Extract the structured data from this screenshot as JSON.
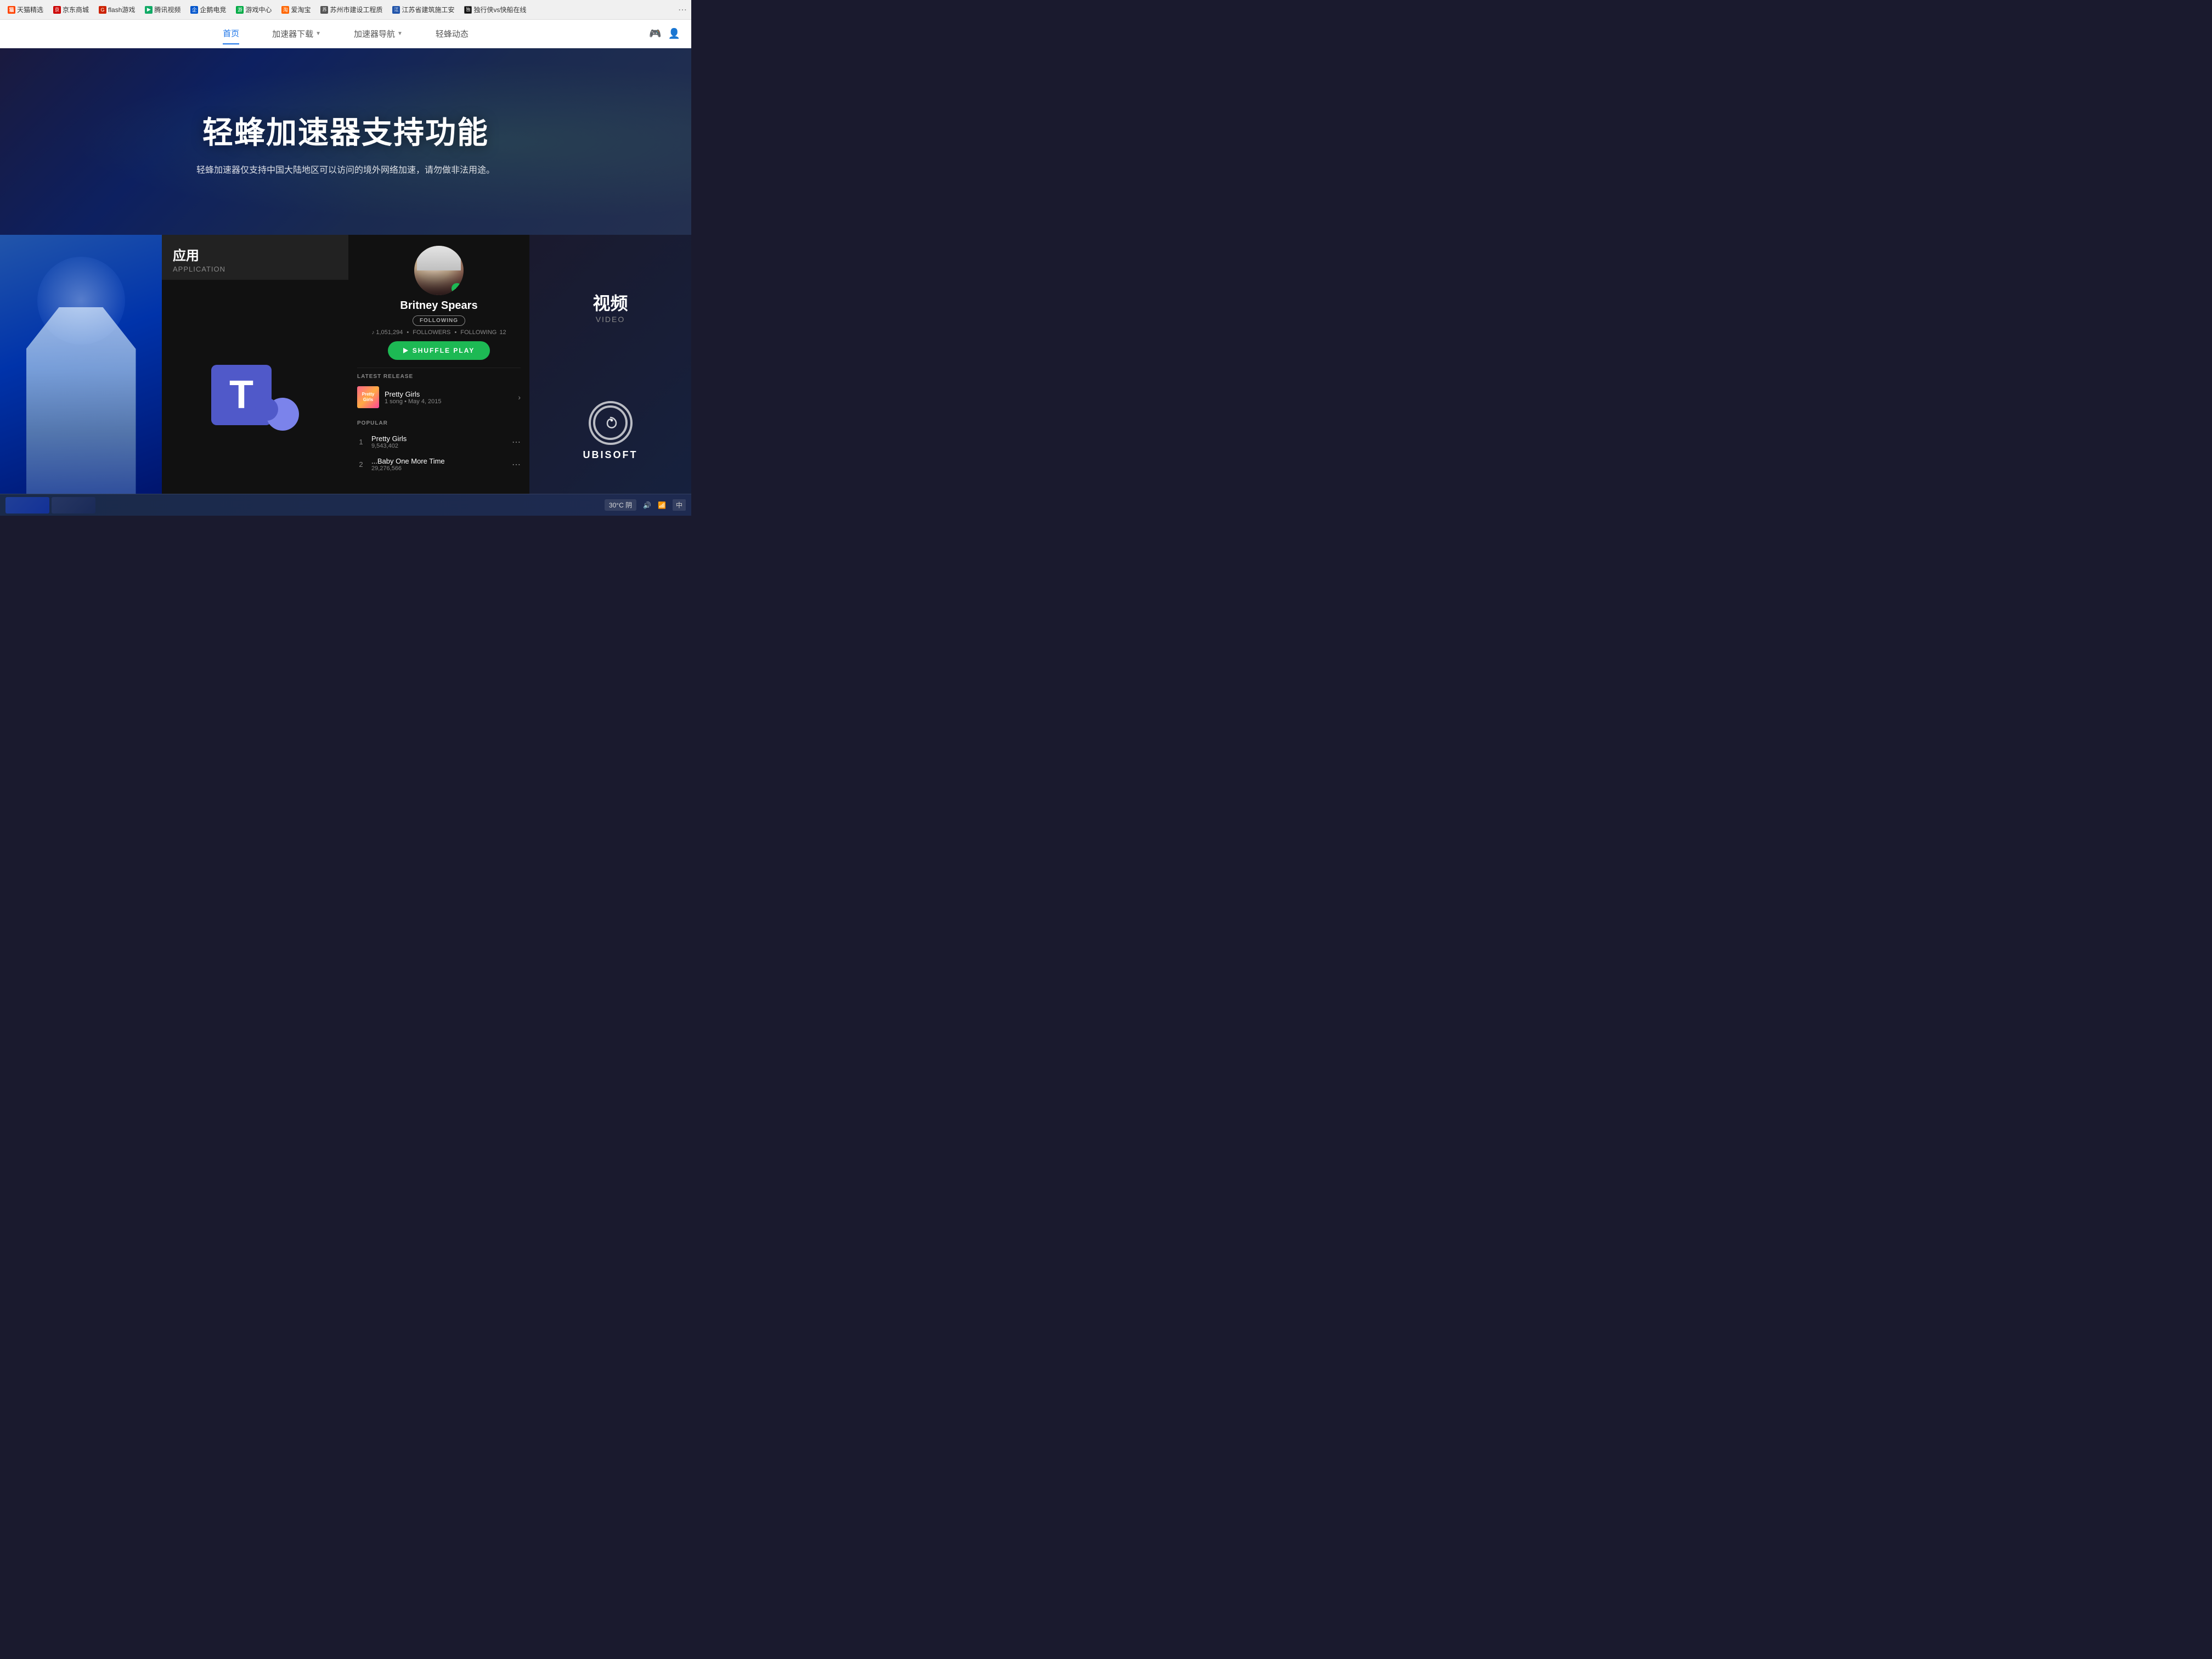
{
  "bookmarks": {
    "items": [
      {
        "label": "天猫精选",
        "color": "#ff4400"
      },
      {
        "label": "京东商城",
        "color": "#cc0000"
      },
      {
        "label": "flash游戏",
        "color": "#cc2200"
      },
      {
        "label": "腾讯视频",
        "color": "#3399ff"
      },
      {
        "label": "企鹅电竞",
        "color": "#0055cc"
      },
      {
        "label": "游戏中心",
        "color": "#00aa44"
      },
      {
        "label": "爱淘宝",
        "color": "#ff6600"
      },
      {
        "label": "苏州市建设工程质",
        "color": "#555"
      },
      {
        "label": "江苏省建筑施工安",
        "color": "#555"
      },
      {
        "label": "独行侠vs快船在线",
        "color": "#333"
      }
    ]
  },
  "nav": {
    "items": [
      {
        "label": "首页",
        "active": true
      },
      {
        "label": "加速器下载",
        "has_dropdown": true
      },
      {
        "label": "加速器导航",
        "has_dropdown": true
      },
      {
        "label": "轻蜂动态"
      }
    ]
  },
  "hero": {
    "title": "轻蜂加速器支持功能",
    "subtitle": "轻蜂加速器仅支持中国大陆地区可以访问的境外网络加速，请勿做非法用途。"
  },
  "app_panel": {
    "title_zh": "应用",
    "title_en": "APPLICATION"
  },
  "spotify": {
    "artist_name": "Britney Spears",
    "verified": true,
    "following_label": "FOLLOWING",
    "followers_count": "1,051,294",
    "following_count": "12",
    "followers_label": "FOLLOWERS",
    "following_label2": "FOLLOWING",
    "shuffle_label": "SHUFFLE PLAY",
    "latest_release_label": "LATEST RELEASE",
    "release_title": "Pretty Girls",
    "release_meta": "1 song • May 4, 2015",
    "popular_label": "POPULAR",
    "tracks": [
      {
        "number": "1",
        "title": "Pretty Girls",
        "plays": "9,543,402"
      },
      {
        "number": "2",
        "title": "...Baby One More Time",
        "plays": "29,276,566"
      }
    ]
  },
  "video_panel": {
    "title_zh": "视频",
    "title_en": "VIDEO"
  },
  "ubisoft": {
    "name": "UBISOFT"
  },
  "taskbar": {
    "temp": "30°C 阴",
    "lang": "中"
  }
}
